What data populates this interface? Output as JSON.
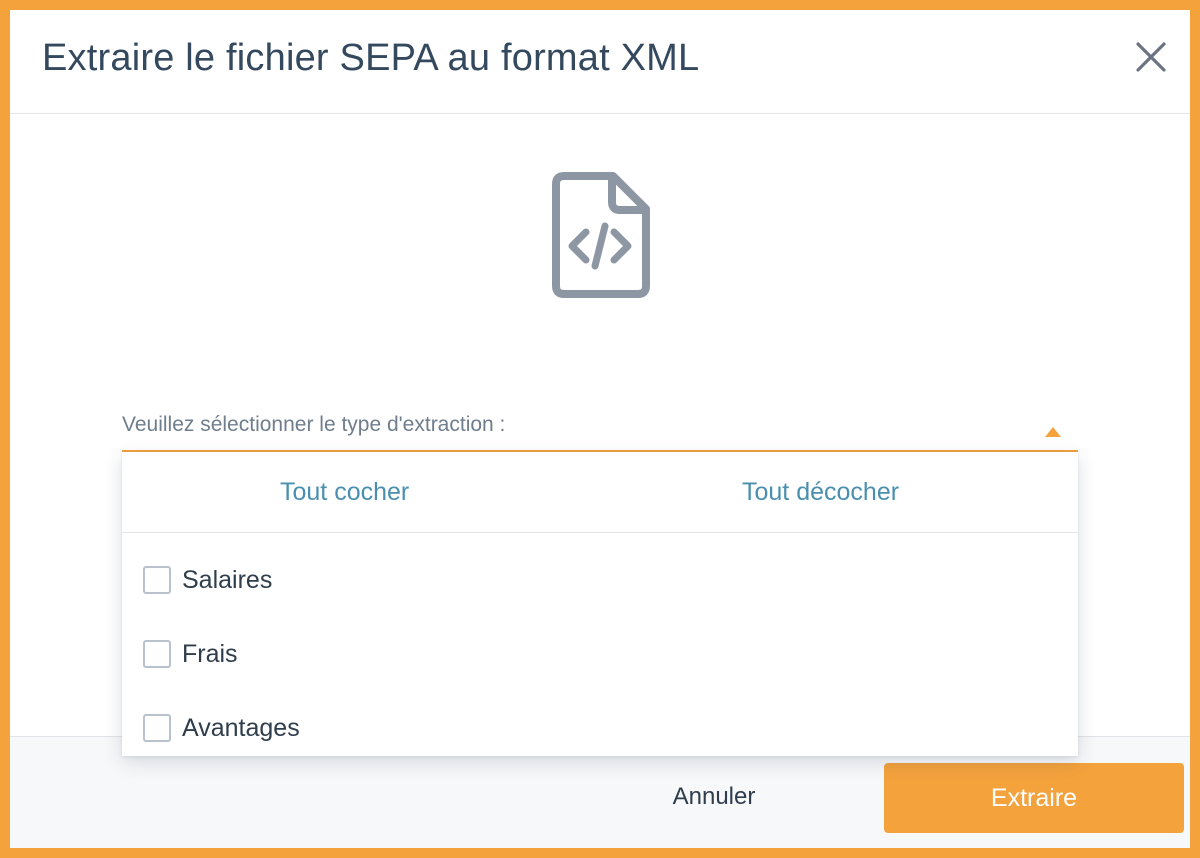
{
  "modal": {
    "title": "Extraire le fichier SEPA au format XML",
    "close_icon": "close-icon",
    "file_icon": "xml-file-icon"
  },
  "select": {
    "label": "Veuillez sélectionner le type d'extraction :",
    "arrow_icon": "caret-up-icon",
    "accent_color": "#f4a23c"
  },
  "dropdown": {
    "check_all": "Tout cocher",
    "uncheck_all": "Tout décocher",
    "options": [
      {
        "label": "Salaires",
        "checked": false
      },
      {
        "label": "Frais",
        "checked": false
      },
      {
        "label": "Avantages",
        "checked": false
      }
    ]
  },
  "footer": {
    "cancel_label": "Annuler",
    "extract_label": "Extraire"
  },
  "colors": {
    "brand": "#f4a23c",
    "link": "#4a8fb0",
    "title_text": "#34495e",
    "icon_gray": "#8d97a4"
  }
}
